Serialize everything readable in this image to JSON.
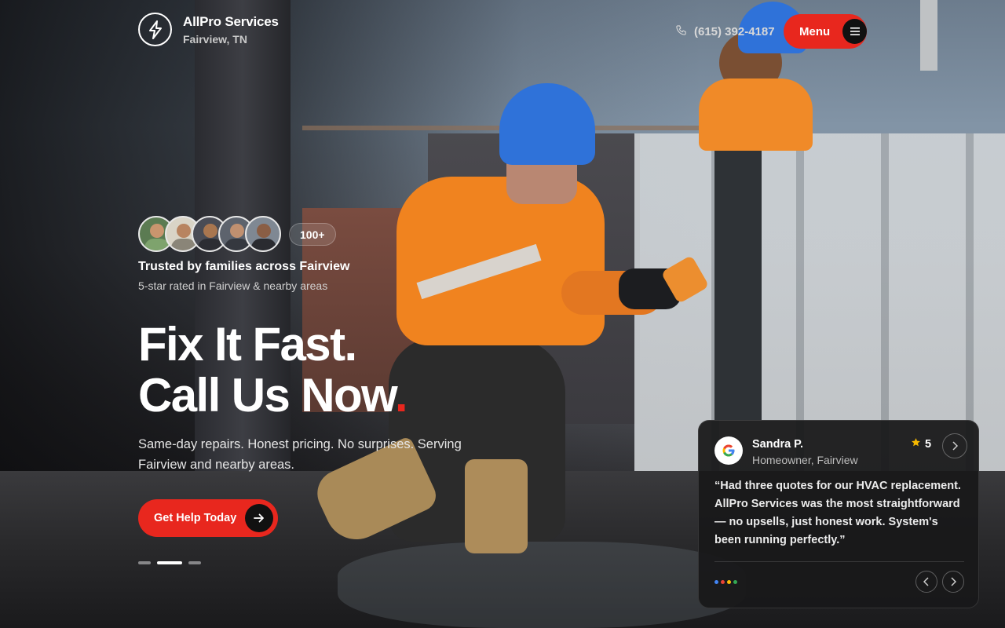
{
  "brand": {
    "name": "AllPro Services",
    "location": "Fairview, TN",
    "logo_icon": "lightning-bolt-icon"
  },
  "header": {
    "phone": "(615) 392-4187",
    "phone_icon": "phone-icon",
    "menu_label": "Menu",
    "menu_icon": "hamburger-icon"
  },
  "trust": {
    "badge": "100+",
    "title": "Trusted by families across Fairview",
    "subtitle": "5-star rated in Fairview & nearby areas"
  },
  "hero": {
    "headline_line1": "Fix It Fast.",
    "headline_line2": "Call Us Now",
    "headline_dot": ".",
    "subcopy": "Same-day repairs. Honest pricing. No surprises. Serving Fairview and nearby areas.",
    "cta_label": "Get Help Today",
    "cta_icon": "arrow-right-icon",
    "slides_total": 3,
    "slide_active": 2
  },
  "review": {
    "source_icon": "google-icon",
    "name": "Sandra P.",
    "role": "Homeowner, Fairview",
    "rating": "5",
    "quote": "“Had three quotes for our HVAC replacement. AllPro Services was the most straightforward — no upsells, just honest work. System's been running perfectly.”"
  },
  "colors": {
    "accent": "#e8271e",
    "google_blue": "#4285F4",
    "google_red": "#EA4335",
    "google_yellow": "#FBBC05",
    "google_green": "#34A853",
    "star": "#f5b800"
  }
}
